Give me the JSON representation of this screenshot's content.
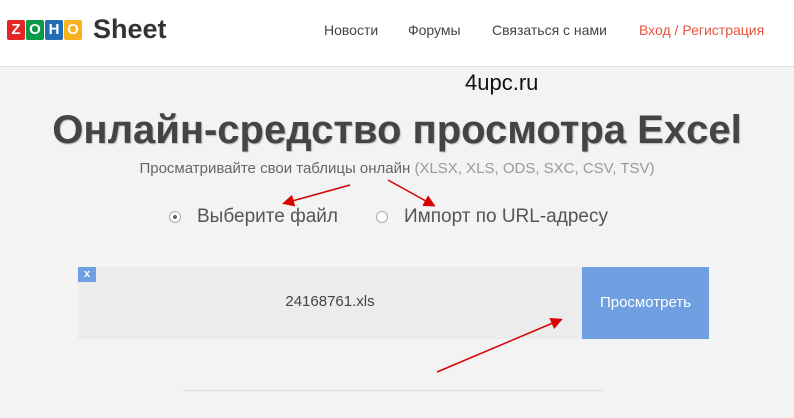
{
  "header": {
    "logo_letters": [
      "Z",
      "O",
      "H",
      "O"
    ],
    "logo_colors": [
      "#e42527",
      "#089949",
      "#226db4",
      "#f9b21d"
    ],
    "app_name": "Sheet",
    "nav": [
      "Новости",
      "Форумы",
      "Связаться с нами",
      "Вход / Регистрация"
    ],
    "login_color": "#e5533d"
  },
  "watermark": "4upc.ru",
  "main": {
    "title": "Онлайн-средство просмотра Excel",
    "subtitle": "Просматривайте свои таблицы онлайн",
    "formats": "(XLSX, XLS, ODS, SXC, CSV, TSV)",
    "options": [
      {
        "label": "Выберите файл",
        "selected": true
      },
      {
        "label": "Импорт по URL-адресу",
        "selected": false
      }
    ],
    "remove_label": "x",
    "file_name": "24168761.xls",
    "view_button": "Просмотреть"
  }
}
